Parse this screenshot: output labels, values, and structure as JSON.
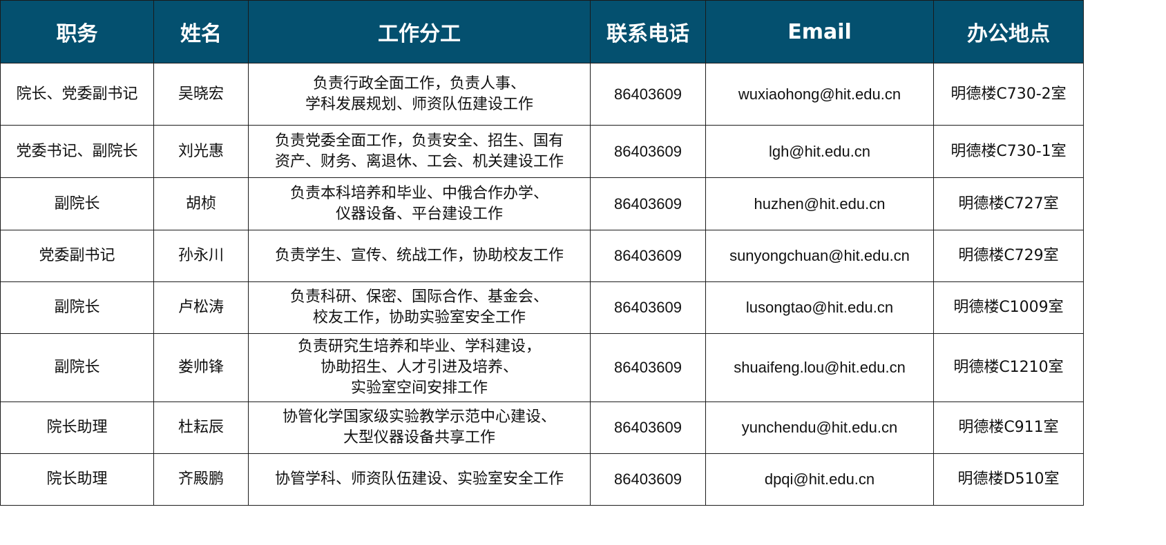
{
  "colors": {
    "header_bg": "#04506f",
    "header_text": "#ffffff",
    "border": "#1a1a1a"
  },
  "headers": [
    "职务",
    "姓名",
    "工作分工",
    "联系电话",
    "Email",
    "办公地点"
  ],
  "rows": [
    {
      "title": "院长、党委副书记",
      "name": "吴晓宏",
      "duties": [
        "负责行政全面工作，负责人事、",
        "学科发展规划、师资队伍建设工作"
      ],
      "phone": "86403609",
      "email": "wuxiaohong@hit.edu.cn",
      "office": "明德楼C730-2室"
    },
    {
      "title": "党委书记、副院长",
      "name": "刘光惠",
      "duties": [
        "负责党委全面工作，负责安全、招生、国有",
        "资产、财务、离退休、工会、机关建设工作"
      ],
      "phone": "86403609",
      "email": "lgh@hit.edu.cn",
      "office": "明德楼C730-1室"
    },
    {
      "title": "副院长",
      "name": "胡桢",
      "duties": [
        "负责本科培养和毕业、中俄合作办学、",
        "仪器设备、平台建设工作"
      ],
      "phone": "86403609",
      "email": "huzhen@hit.edu.cn",
      "office": "明德楼C727室"
    },
    {
      "title": "党委副书记",
      "name": "孙永川",
      "duties": [
        "负责学生、宣传、统战工作，协助校友工作"
      ],
      "phone": "86403609",
      "email": "sunyongchuan@hit.edu.cn",
      "office": "明德楼C729室"
    },
    {
      "title": "副院长",
      "name": "卢松涛",
      "duties": [
        "负责科研、保密、国际合作、基金会、",
        "校友工作，协助实验室安全工作"
      ],
      "phone": "86403609",
      "email": "lusongtao@hit.edu.cn",
      "office": "明德楼C1009室"
    },
    {
      "title": "副院长",
      "name": "娄帅锋",
      "duties": [
        "负责研究生培养和毕业、学科建设，",
        "协助招生、人才引进及培养、",
        "实验室空间安排工作"
      ],
      "phone": "86403609",
      "email": "shuaifeng.lou@hit.edu.cn",
      "office": "明德楼C1210室"
    },
    {
      "title": "院长助理",
      "name": "杜耘辰",
      "duties": [
        "协管化学国家级实验教学示范中心建设、",
        "大型仪器设备共享工作"
      ],
      "phone": "86403609",
      "email": "yunchendu@hit.edu.cn",
      "office": "明德楼C911室"
    },
    {
      "title": "院长助理",
      "name": "齐殿鹏",
      "duties": [
        "协管学科、师资队伍建设、实验室安全工作"
      ],
      "phone": "86403609",
      "email": "dpqi@hit.edu.cn",
      "office": "明德楼D510室"
    }
  ]
}
